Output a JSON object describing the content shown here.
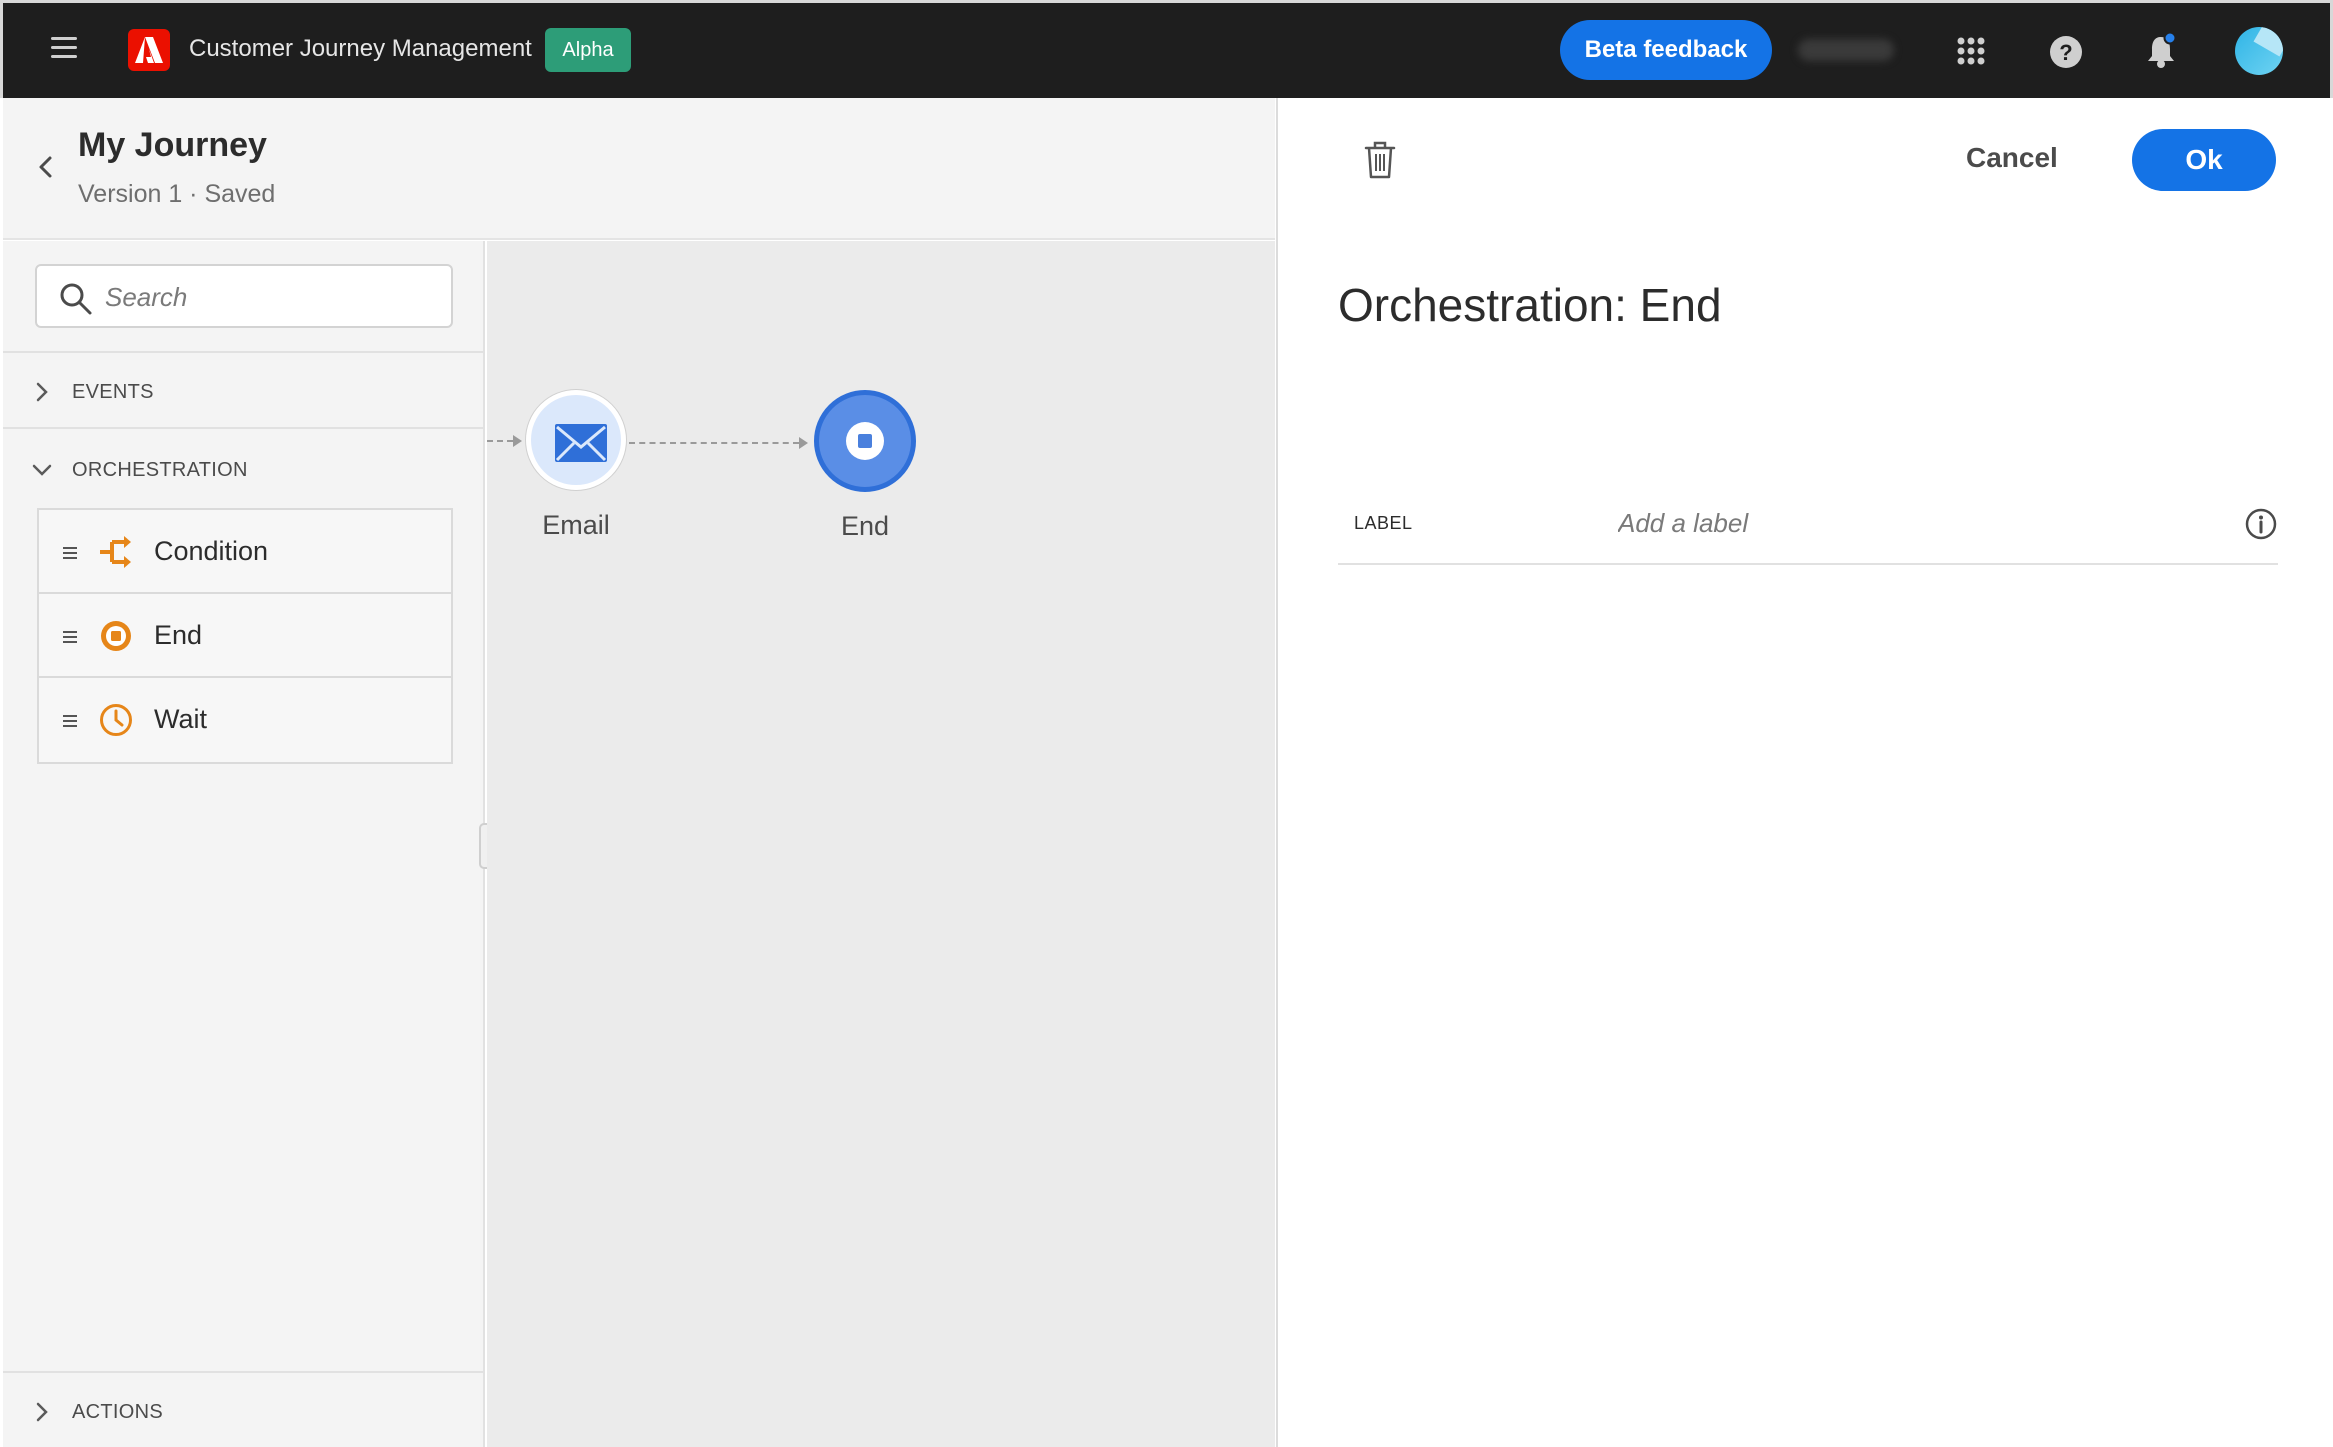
{
  "topbar": {
    "app_title": "Customer Journey Management",
    "badge": "Alpha",
    "beta_feedback": "Beta feedback",
    "icons": [
      "menu-icon",
      "adobe-logo",
      "apps-icon",
      "help-icon",
      "bell-icon",
      "avatar"
    ]
  },
  "journey": {
    "title": "My Journey",
    "status": "Version 1 · Saved"
  },
  "palette": {
    "search_placeholder": "Search",
    "sections": {
      "events": "EVENTS",
      "orchestration": "ORCHESTRATION",
      "actions": "ACTIONS"
    },
    "orchestration_items": [
      {
        "label": "Condition",
        "icon": "condition-icon"
      },
      {
        "label": "End",
        "icon": "end-icon"
      },
      {
        "label": "Wait",
        "icon": "clock-icon"
      }
    ]
  },
  "canvas": {
    "nodes": [
      {
        "label": "Email",
        "icon": "email-icon"
      },
      {
        "label": "End",
        "icon": "stop-icon",
        "selected": true
      }
    ]
  },
  "panel": {
    "title": "Orchestration: End",
    "cancel": "Cancel",
    "ok": "Ok",
    "field_label": "LABEL",
    "field_placeholder": "Add a label",
    "field_value": ""
  },
  "colors": {
    "accent": "#1473e6",
    "orchestration": "#e68619",
    "topbar": "#1e1e1e",
    "badge": "#2d9d78",
    "adobe_red": "#eb1000"
  }
}
